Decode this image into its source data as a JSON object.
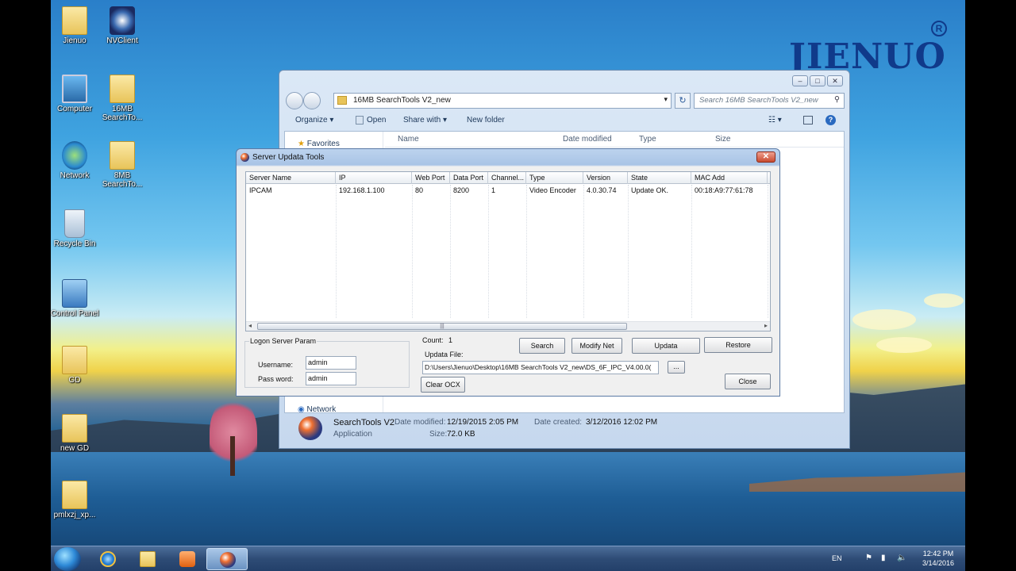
{
  "desktop": {
    "logo_text": "JIENUO",
    "logo_reg": "R",
    "icons": [
      {
        "label": "Jienuo"
      },
      {
        "label": "NVClient"
      },
      {
        "label": "Computer"
      },
      {
        "label": "16MB SearchTo..."
      },
      {
        "label": "Network"
      },
      {
        "label": "8MB SearchTo..."
      },
      {
        "label": "Recycle Bin"
      },
      {
        "label": "Control Panel"
      },
      {
        "label": "GD"
      },
      {
        "label": "new GD"
      },
      {
        "label": "pmlxzj_xp..."
      }
    ]
  },
  "explorer": {
    "caption_buttons": [
      "–",
      "□",
      "✕"
    ],
    "address": "16MB SearchTools V2_new",
    "search_placeholder": "Search 16MB SearchTools V2_new",
    "toolbar": {
      "organize": "Organize ▾",
      "open": "Open",
      "share_with": "Share with ▾",
      "new_folder": "New folder"
    },
    "columns": {
      "name": "Name",
      "date_modified": "Date modified",
      "type": "Type",
      "size": "Size"
    },
    "sidebar": {
      "favorites": "Favorites",
      "network": "Network"
    },
    "details": {
      "name": "SearchTools V2",
      "type": "Application",
      "date_modified_label": "Date modified:",
      "date_modified": "12/19/2015 2:05 PM",
      "size_label": "Size:",
      "size": "72.0 KB",
      "date_created_label": "Date created:",
      "date_created": "3/12/2016 12:02 PM"
    }
  },
  "dialog": {
    "title": "Server Updata Tools",
    "close": "✕",
    "grid": {
      "headers": [
        "Server Name",
        "IP",
        "Web Port",
        "Data Port",
        "Channel...",
        "Type",
        "Version",
        "State",
        "MAC Add"
      ],
      "rows": [
        [
          "IPCAM",
          "192.168.1.100",
          "80",
          "8200",
          "1",
          "Video Encoder",
          "4.0.30.74",
          "Update OK.",
          "00:18:A9:77:61:78"
        ]
      ],
      "scroll_grip": "|||"
    },
    "logon": {
      "legend": "Logon Server Param",
      "username_label": "Username:",
      "username": "admin",
      "password_label": "Pass word:",
      "password": "admin"
    },
    "count_label": "Count:",
    "count": "1",
    "updata_file_label": "Updata File:",
    "updata_file": "D:\\Users\\Jienuo\\Desktop\\16MB SearchTools V2_new\\DS_6F_IPC_V4.00.0(",
    "browse": "...",
    "buttons": {
      "search": "Search",
      "modify_net": "Modify Net",
      "updata": "Updata",
      "restore": "Restore",
      "clear_ocx": "Clear OCX",
      "close": "Close"
    }
  },
  "taskbar": {
    "language": "EN",
    "time": "12:42 PM",
    "date": "3/14/2016"
  }
}
